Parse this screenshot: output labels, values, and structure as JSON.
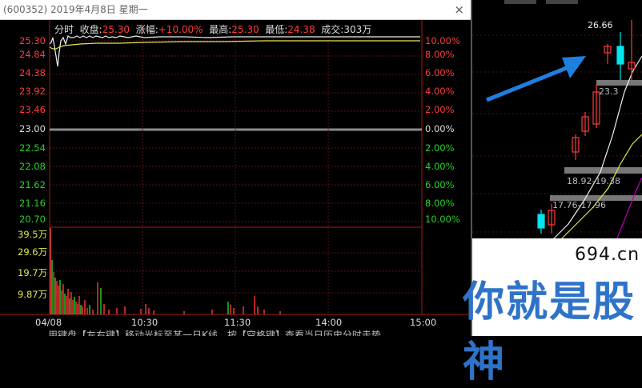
{
  "window": {
    "title": "(600352) 2019年4月8日 星期一",
    "close_glyph": "×"
  },
  "header": {
    "tab_label": "分时",
    "close_label": "收盘:",
    "close_value": "25.30",
    "change_label": "涨幅:",
    "change_value": "+10.00%",
    "high_label": "最高:",
    "high_value": "25.30",
    "low_label": "最低:",
    "low_value": "24.38",
    "volume_label": "成交:",
    "volume_value": "303万"
  },
  "price_axis": {
    "left_labels": [
      "25.30",
      "24.84",
      "24.38",
      "23.92",
      "23.46",
      "23.00",
      "22.54",
      "22.08",
      "21.62",
      "21.16",
      "20.70"
    ],
    "right_labels": [
      "10.00%",
      "8.00%",
      "6.00%",
      "4.00%",
      "2.00%",
      "0.00%",
      "2.00%",
      "4.00%",
      "6.00%",
      "8.00%",
      "10.00%"
    ]
  },
  "volume_axis": {
    "labels": [
      "39.5万",
      "29.6万",
      "19.7万",
      "9.87万"
    ]
  },
  "time_axis": {
    "labels": [
      "04/08",
      "10:30",
      "11:30",
      "14:00",
      "15:00"
    ]
  },
  "footer": {
    "hint": "用键盘【左右键】移动光标至某一日K线，按【空格键】查看当日历史分时走势"
  },
  "kline_panel": {
    "high_label": "26.66",
    "range_label_1": "23.3",
    "range_label_2": "18.92-19.38",
    "range_label_3": "17.76-17.96"
  },
  "watermark": {
    "domain": "694.cn",
    "slogan": "你就是股神"
  },
  "colors": {
    "up": "#ff3b3b",
    "down": "#24d424",
    "neutral": "#dddddd",
    "avg_line": "#e6e650",
    "arrow": "#1f7fe0",
    "logo": "#2f73c9"
  }
}
